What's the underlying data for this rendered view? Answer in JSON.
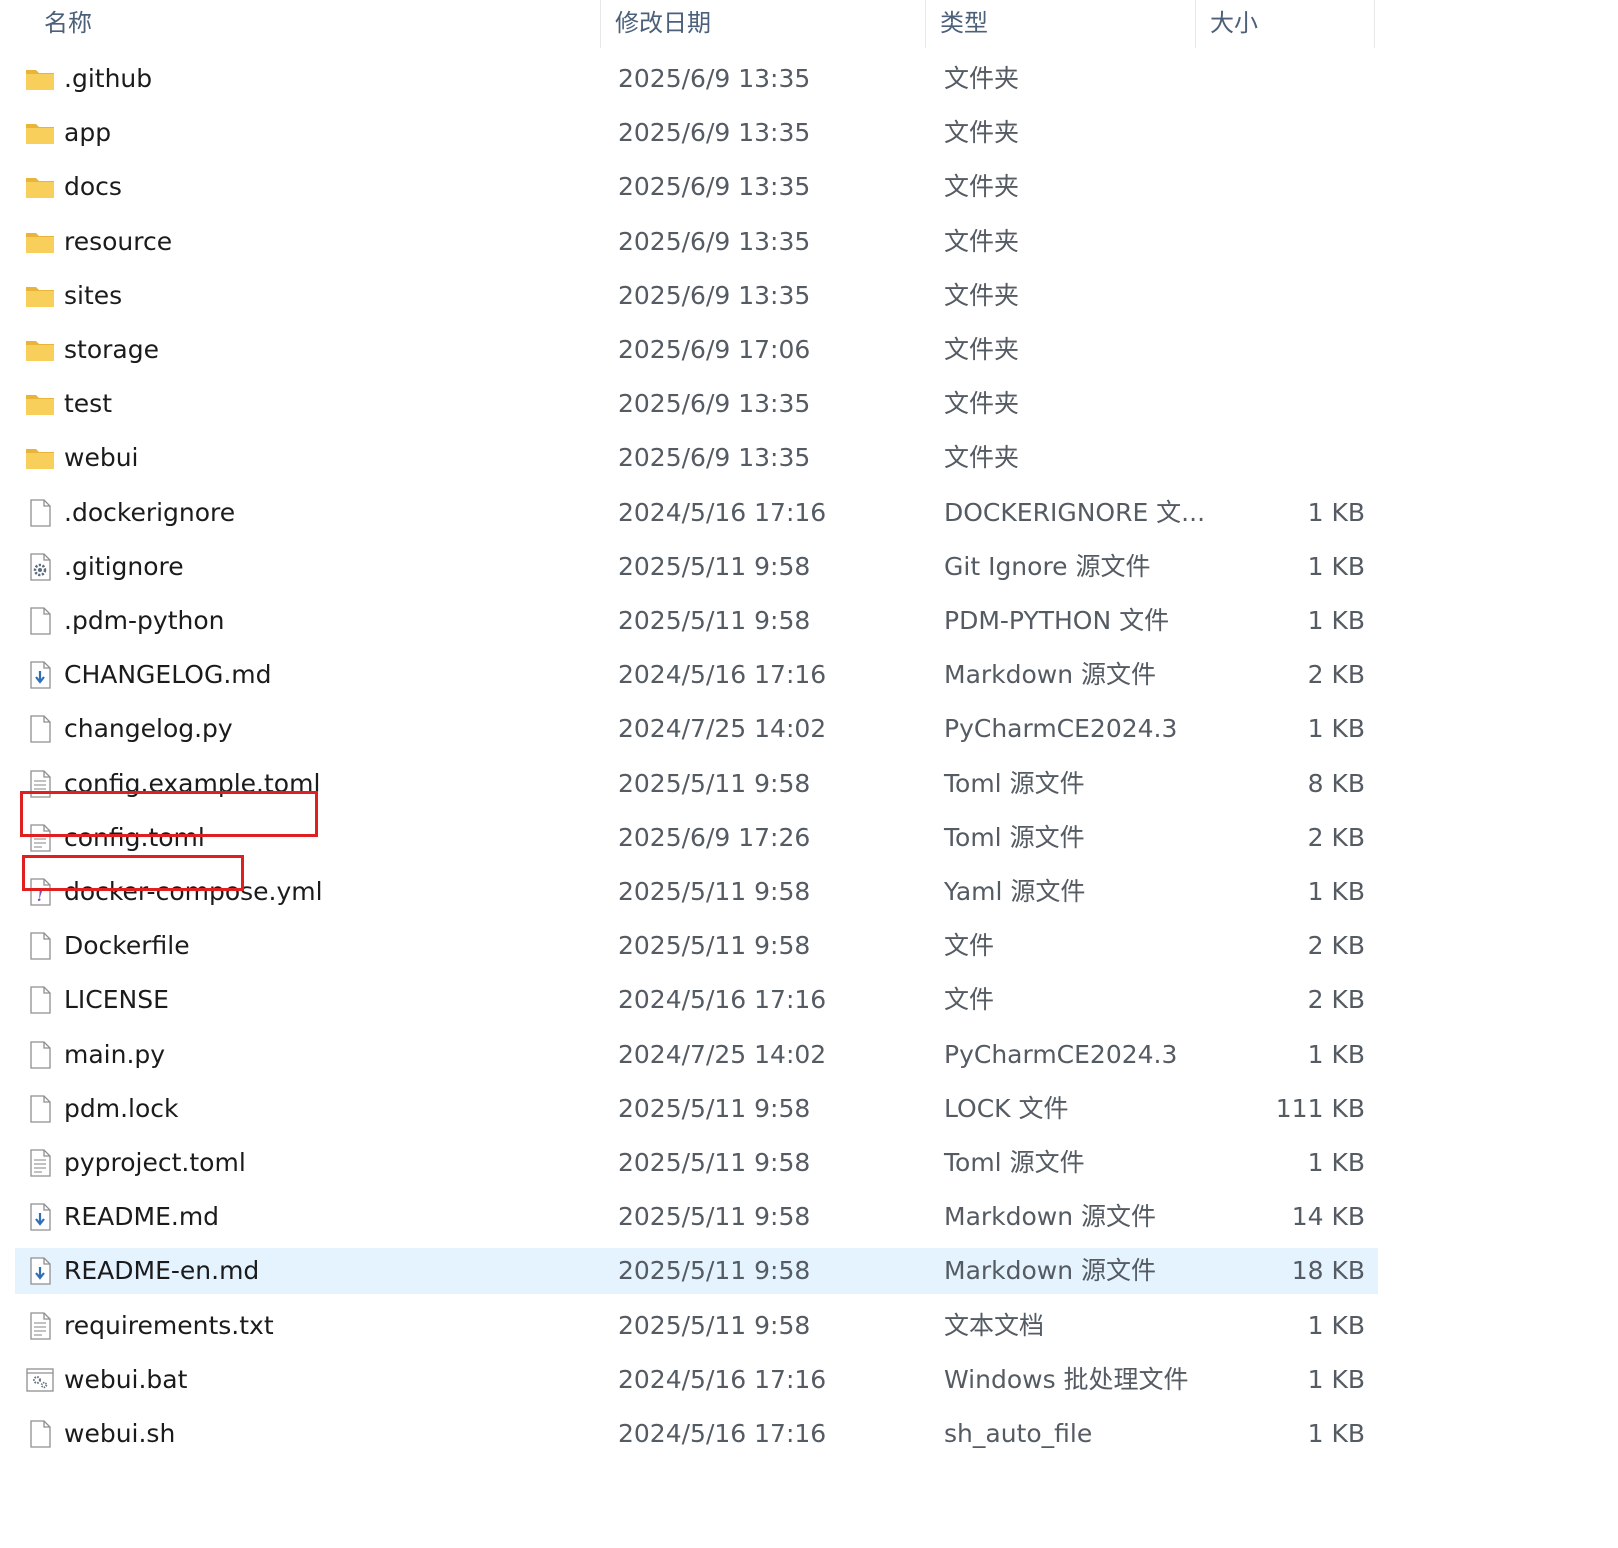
{
  "columns": {
    "name": "名称",
    "modified": "修改日期",
    "type": "类型",
    "size": "大小"
  },
  "files": [
    {
      "name": ".github",
      "modified": "2025/6/9 13:35",
      "type": "文件夹",
      "size": "",
      "icon": "folder-icon"
    },
    {
      "name": "app",
      "modified": "2025/6/9 13:35",
      "type": "文件夹",
      "size": "",
      "icon": "folder-icon"
    },
    {
      "name": "docs",
      "modified": "2025/6/9 13:35",
      "type": "文件夹",
      "size": "",
      "icon": "folder-icon"
    },
    {
      "name": "resource",
      "modified": "2025/6/9 13:35",
      "type": "文件夹",
      "size": "",
      "icon": "folder-icon"
    },
    {
      "name": "sites",
      "modified": "2025/6/9 13:35",
      "type": "文件夹",
      "size": "",
      "icon": "folder-icon"
    },
    {
      "name": "storage",
      "modified": "2025/6/9 17:06",
      "type": "文件夹",
      "size": "",
      "icon": "folder-icon"
    },
    {
      "name": "test",
      "modified": "2025/6/9 13:35",
      "type": "文件夹",
      "size": "",
      "icon": "folder-icon"
    },
    {
      "name": "webui",
      "modified": "2025/6/9 13:35",
      "type": "文件夹",
      "size": "",
      "icon": "folder-icon"
    },
    {
      "name": ".dockerignore",
      "modified": "2024/5/16 17:16",
      "type": "DOCKERIGNORE 文...",
      "size": "1 KB",
      "icon": "blank-file-icon"
    },
    {
      "name": ".gitignore",
      "modified": "2025/5/11 9:58",
      "type": "Git Ignore 源文件",
      "size": "1 KB",
      "icon": "gear-file-icon"
    },
    {
      "name": ".pdm-python",
      "modified": "2025/5/11 9:58",
      "type": "PDM-PYTHON 文件",
      "size": "1 KB",
      "icon": "blank-file-icon"
    },
    {
      "name": "CHANGELOG.md",
      "modified": "2024/5/16 17:16",
      "type": "Markdown 源文件",
      "size": "2 KB",
      "icon": "markdown-file-icon"
    },
    {
      "name": "changelog.py",
      "modified": "2024/7/25 14:02",
      "type": "PyCharmCE2024.3",
      "size": "1 KB",
      "icon": "blank-file-icon"
    },
    {
      "name": "config.example.toml",
      "modified": "2025/5/11 9:58",
      "type": "Toml 源文件",
      "size": "8 KB",
      "icon": "text-file-icon"
    },
    {
      "name": "config.toml",
      "modified": "2025/6/9 17:26",
      "type": "Toml 源文件",
      "size": "2 KB",
      "icon": "text-file-icon"
    },
    {
      "name": "docker-compose.yml",
      "modified": "2025/5/11 9:58",
      "type": "Yaml 源文件",
      "size": "1 KB",
      "icon": "yaml-file-icon"
    },
    {
      "name": "Dockerfile",
      "modified": "2025/5/11 9:58",
      "type": "文件",
      "size": "2 KB",
      "icon": "blank-file-icon"
    },
    {
      "name": "LICENSE",
      "modified": "2024/5/16 17:16",
      "type": "文件",
      "size": "2 KB",
      "icon": "blank-file-icon"
    },
    {
      "name": "main.py",
      "modified": "2024/7/25 14:02",
      "type": "PyCharmCE2024.3",
      "size": "1 KB",
      "icon": "blank-file-icon"
    },
    {
      "name": "pdm.lock",
      "modified": "2025/5/11 9:58",
      "type": "LOCK 文件",
      "size": "111 KB",
      "icon": "blank-file-icon"
    },
    {
      "name": "pyproject.toml",
      "modified": "2025/5/11 9:58",
      "type": "Toml 源文件",
      "size": "1 KB",
      "icon": "text-file-icon"
    },
    {
      "name": "README.md",
      "modified": "2025/5/11 9:58",
      "type": "Markdown 源文件",
      "size": "14 KB",
      "icon": "markdown-file-icon"
    },
    {
      "name": "README-en.md",
      "modified": "2025/5/11 9:58",
      "type": "Markdown 源文件",
      "size": "18 KB",
      "icon": "markdown-file-icon",
      "selected": true
    },
    {
      "name": "requirements.txt",
      "modified": "2025/5/11 9:58",
      "type": "文本文档",
      "size": "1 KB",
      "icon": "text-file-icon"
    },
    {
      "name": "webui.bat",
      "modified": "2024/5/16 17:16",
      "type": "Windows 批处理文件",
      "size": "1 KB",
      "icon": "batch-file-icon"
    },
    {
      "name": "webui.sh",
      "modified": "2024/5/16 17:16",
      "type": "sh_auto_file",
      "size": "1 KB",
      "icon": "blank-file-icon"
    }
  ],
  "colors": {
    "selection": "#e5f3ff",
    "highlight_box": "#e02020",
    "folder": "#f4c542",
    "header_text": "#4c607a"
  }
}
